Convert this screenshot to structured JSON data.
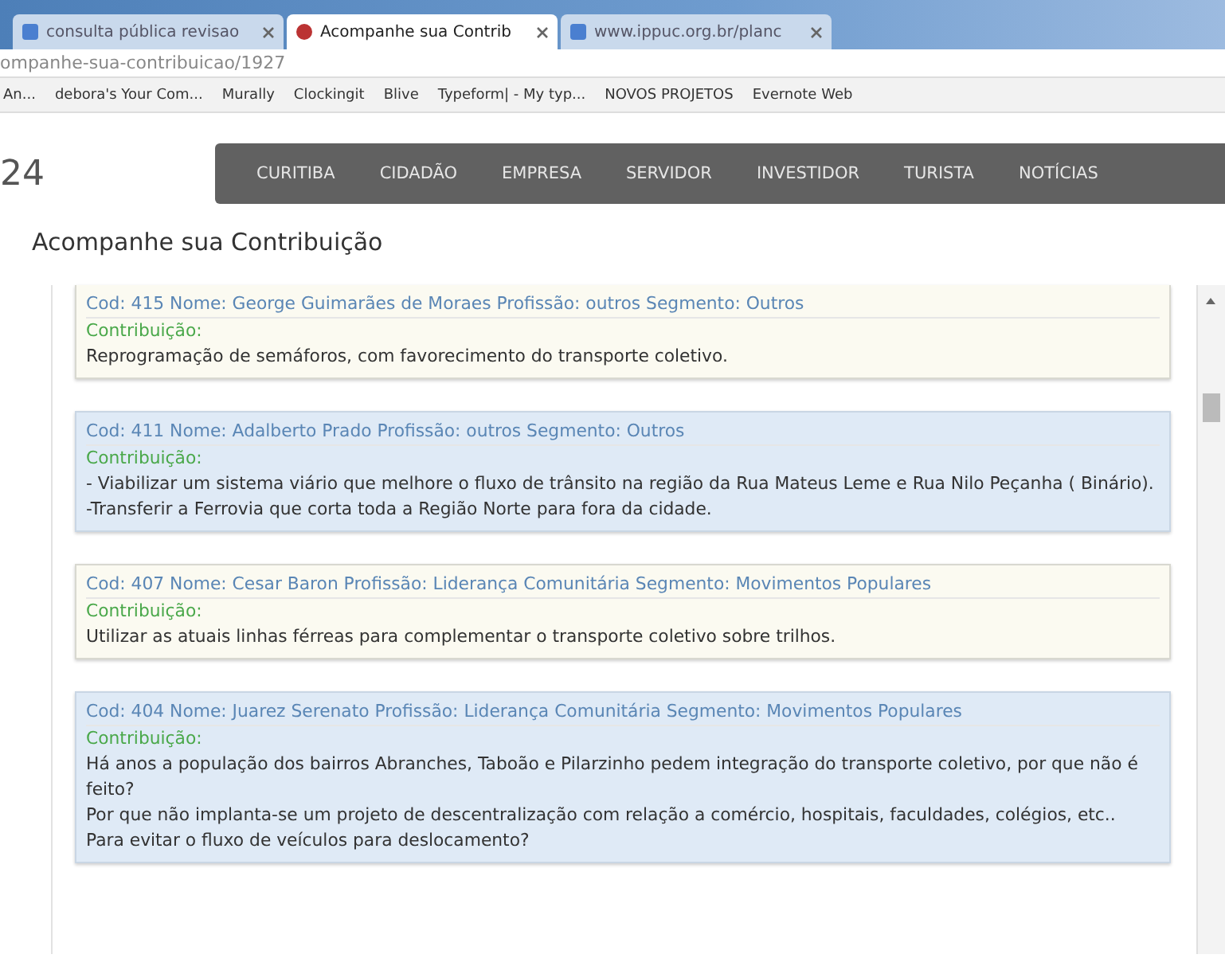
{
  "browser": {
    "tabs": [
      {
        "title": "consulta pública revisao",
        "selected": false
      },
      {
        "title": "Acompanhe sua Contrib",
        "selected": true
      },
      {
        "title": "www.ippuc.org.br/planc",
        "selected": false
      }
    ],
    "address": "ompanhe-sua-contribuicao/1927",
    "bookmarks": [
      "An...",
      "debora's Your Com...",
      "Murally",
      "Clockingit",
      "Blive",
      "Typeform| - My typ...",
      "NOVOS PROJETOS",
      "Evernote Web"
    ]
  },
  "site": {
    "logo_fragment": "24",
    "nav": [
      "CURITIBA",
      "CIDADÃO",
      "EMPRESA",
      "SERVIDOR",
      "INVESTIDOR",
      "TURISTA",
      "NOTÍCIAS"
    ]
  },
  "page_title": "Acompanhe sua Contribuição",
  "contributions": [
    {
      "header": "Cod: 415 Nome: George Guimarães de Moraes Profissão: outros Segmento: Outros",
      "label": "Contribuição:",
      "highlighted": false,
      "text": [
        "Reprogramação de semáforos, com favorecimento do transporte coletivo."
      ]
    },
    {
      "header": "Cod: 411 Nome: Adalberto Prado Profissão: outros Segmento: Outros",
      "label": "Contribuição:",
      "highlighted": true,
      "text": [
        "- Viabilizar um sistema viário que melhore o fluxo de trânsito na região da Rua Mateus Leme e Rua Nilo Peçanha ( Binário).",
        "-Transferir a Ferrovia que corta toda a Região Norte para fora da cidade."
      ]
    },
    {
      "header": "Cod: 407 Nome: Cesar Baron Profissão: Liderança Comunitária Segmento: Movimentos Populares",
      "label": "Contribuição:",
      "highlighted": false,
      "text": [
        "Utilizar as atuais linhas férreas para complementar o transporte coletivo sobre trilhos."
      ]
    },
    {
      "header": "Cod: 404 Nome: Juarez Serenato Profissão: Liderança Comunitária Segmento: Movimentos Populares",
      "label": "Contribuição:",
      "highlighted": true,
      "text": [
        "Há anos a população dos bairros Abranches, Taboão e Pilarzinho pedem integração do transporte coletivo, por que não é feito?",
        "Por que não implanta-se um projeto de descentralização com relação a comércio, hospitais, faculdades, colégios, etc..",
        "Para evitar o fluxo de veículos para deslocamento?"
      ]
    }
  ]
}
